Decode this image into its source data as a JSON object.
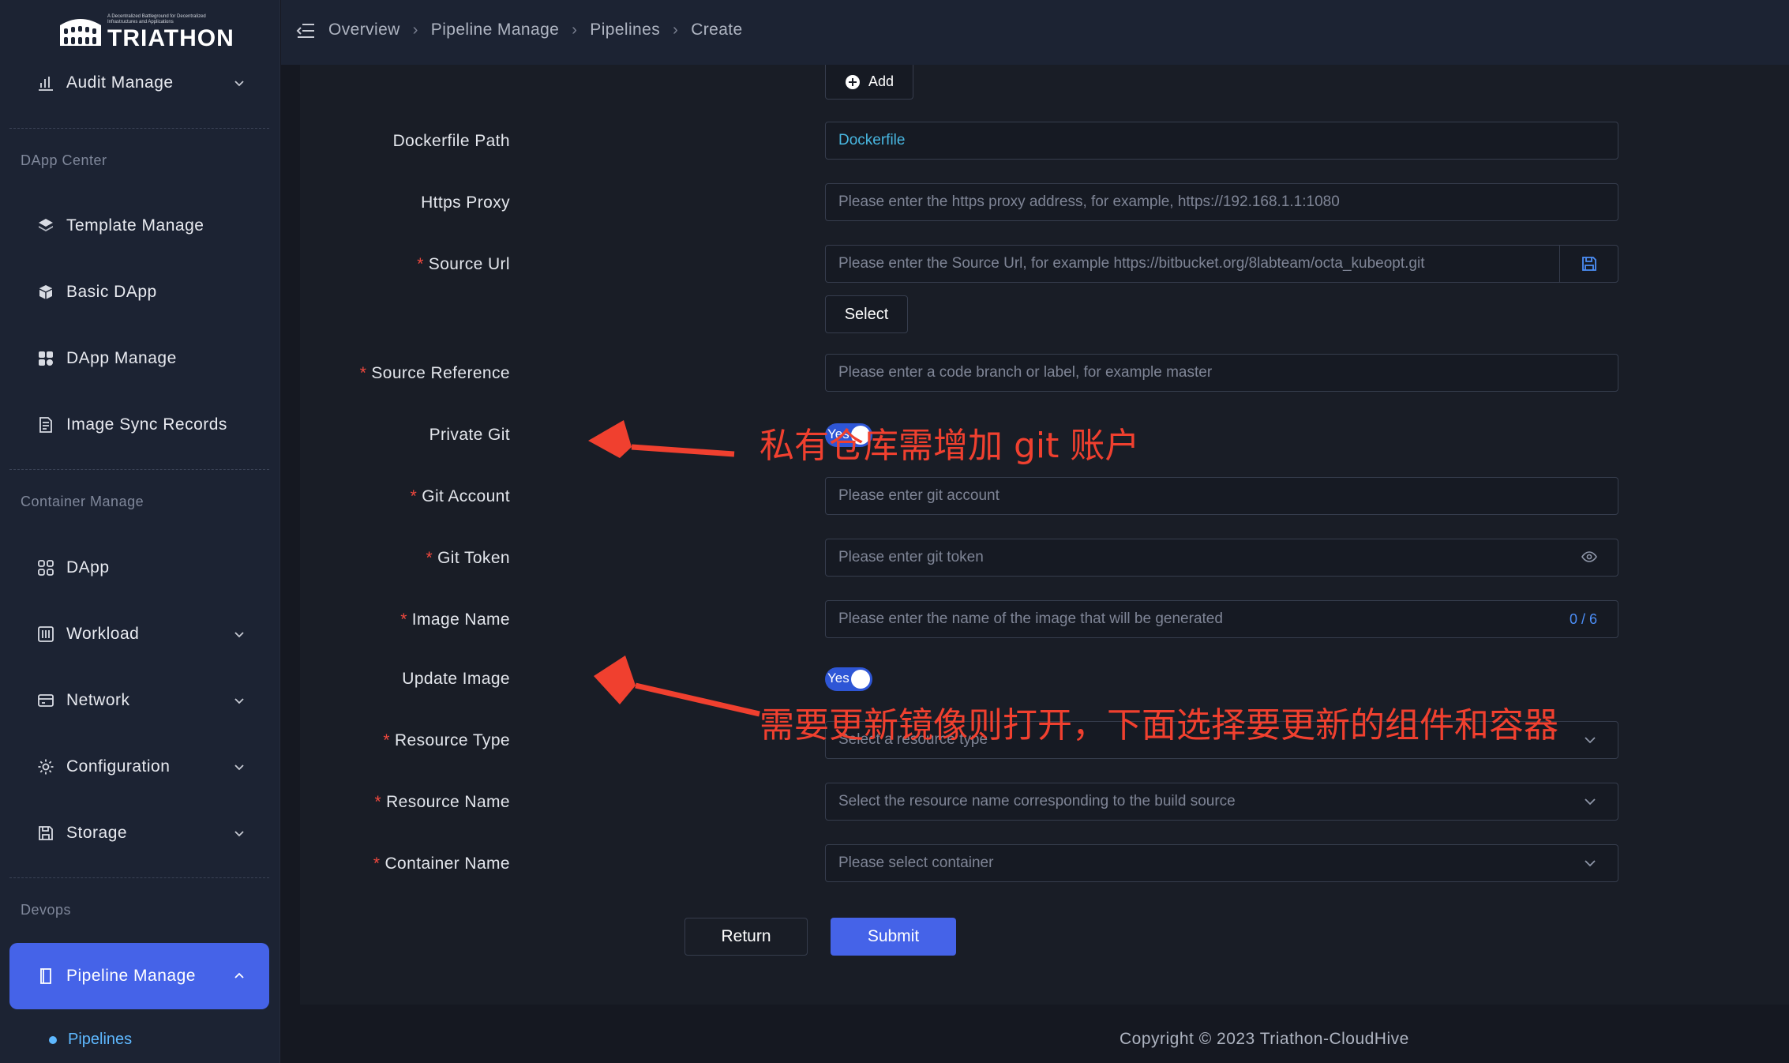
{
  "logo": {
    "text": "TRIATHON",
    "tagline": "A Decentralized Battleground for Decentralized Infrastructures and Applications"
  },
  "sidebar": {
    "audit": {
      "label": "Audit Manage",
      "icon": "bar-chart-icon"
    },
    "sections": {
      "dapp_center": "DApp Center",
      "container_manage": "Container Manage",
      "devops": "Devops"
    },
    "items": [
      {
        "label": "Template Manage",
        "icon": "layers-icon"
      },
      {
        "label": "Basic DApp",
        "icon": "cube-icon"
      },
      {
        "label": "DApp Manage",
        "icon": "apps-icon"
      },
      {
        "label": "Image Sync Records",
        "icon": "records-icon"
      },
      {
        "label": "DApp",
        "icon": "grid-icon"
      },
      {
        "label": "Workload",
        "icon": "workload-icon"
      },
      {
        "label": "Network",
        "icon": "network-icon"
      },
      {
        "label": "Configuration",
        "icon": "gear-icon"
      },
      {
        "label": "Storage",
        "icon": "save-icon"
      }
    ],
    "pipeline": {
      "label": "Pipeline Manage",
      "icon": "book-icon"
    },
    "sub": {
      "pipelines": "Pipelines"
    }
  },
  "breadcrumb": [
    "Overview",
    "Pipeline Manage",
    "Pipelines",
    "Create"
  ],
  "form": {
    "add_label": "Add",
    "dockerfile_path": {
      "label": "Dockerfile Path",
      "value": "Dockerfile"
    },
    "https_proxy": {
      "label": "Https Proxy",
      "placeholder": "Please enter the https proxy address, for example, https://192.168.1.1:1080"
    },
    "source_url": {
      "label": "Source Url",
      "placeholder": "Please enter the Source Url, for example https://bitbucket.org/8labteam/octa_kubeopt.git"
    },
    "select_label": "Select",
    "source_reference": {
      "label": "Source Reference",
      "placeholder": "Please enter a code branch or label, for example master"
    },
    "private_git": {
      "label": "Private Git",
      "toggle_text": "Yes"
    },
    "git_account": {
      "label": "Git Account",
      "placeholder": "Please enter git account"
    },
    "git_token": {
      "label": "Git Token",
      "placeholder": "Please enter git token"
    },
    "image_name": {
      "label": "Image Name",
      "placeholder": "Please enter the name of the image that will be generated",
      "counter": "0 / 6"
    },
    "update_image": {
      "label": "Update Image",
      "toggle_text": "Yes"
    },
    "resource_type": {
      "label": "Resource Type",
      "placeholder": "Select a resource type"
    },
    "resource_name": {
      "label": "Resource Name",
      "placeholder": "Select the resource name corresponding to the build source"
    },
    "container_name": {
      "label": "Container Name",
      "placeholder": "Please select container"
    },
    "return_label": "Return",
    "submit_label": "Submit"
  },
  "annotations": {
    "private_git_note": "私有仓库需增加 git 账户",
    "update_image_note": "需要更新镜像则打开，下面选择要更新的组件和容器"
  },
  "footer": "Copyright © 2023 Triathon-CloudHive",
  "colors": {
    "accent": "#4563e8",
    "annotation": "#f0402f",
    "link": "#48b6e0"
  }
}
